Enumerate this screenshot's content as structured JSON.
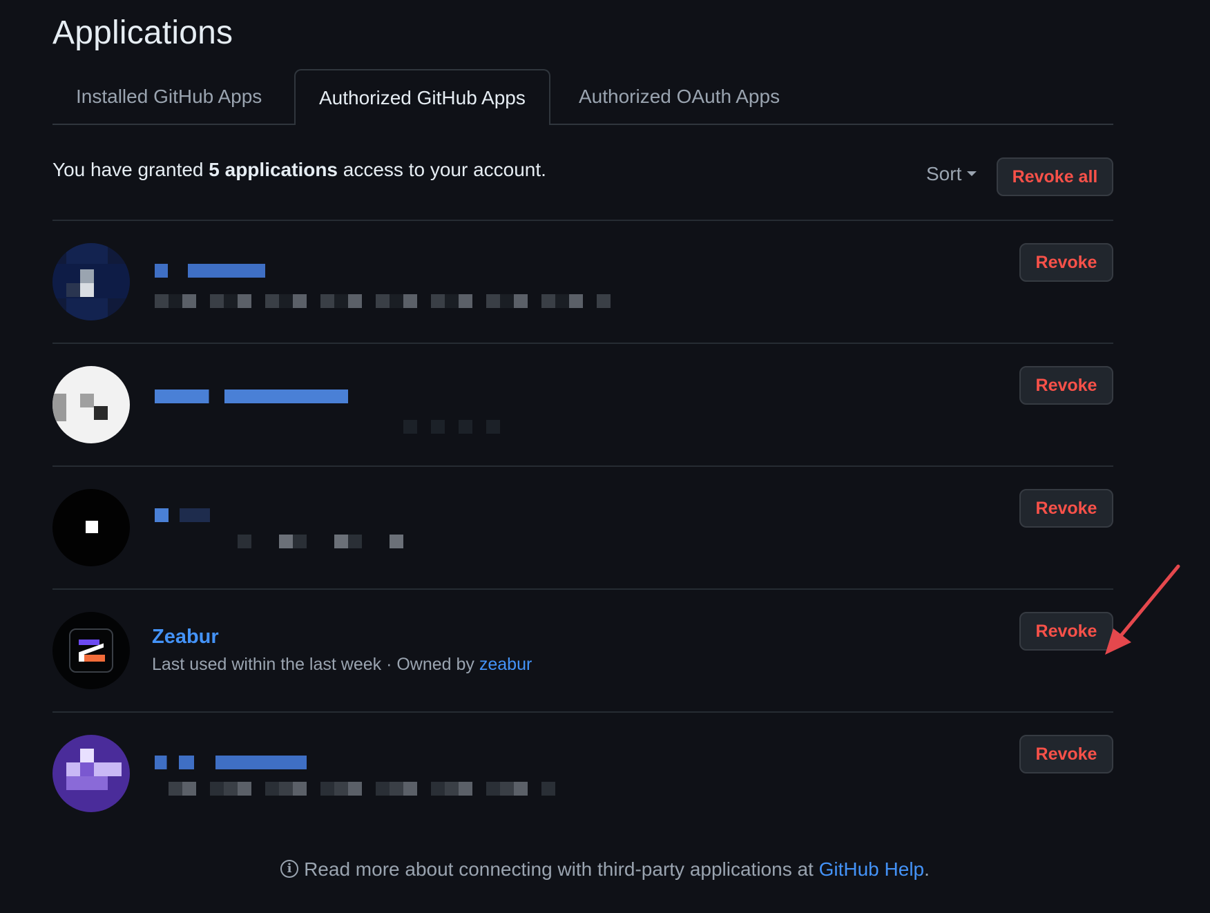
{
  "page": {
    "title": "Applications"
  },
  "tabs": [
    {
      "label": "Installed GitHub Apps",
      "active": false
    },
    {
      "label": "Authorized GitHub Apps",
      "active": true
    },
    {
      "label": "Authorized OAuth Apps",
      "active": false
    }
  ],
  "summary": {
    "prefix": "You have granted ",
    "count": "5 applications",
    "suffix": " access to your account."
  },
  "toolbar": {
    "sort_label": "Sort",
    "revoke_all_label": "Revoke all"
  },
  "apps": [
    {
      "name": "",
      "meta": "",
      "revoke_label": "Revoke",
      "redacted": true
    },
    {
      "name": "",
      "meta": "",
      "revoke_label": "Revoke",
      "redacted": true
    },
    {
      "name": "",
      "meta": "",
      "revoke_label": "Revoke",
      "redacted": true
    },
    {
      "name": "Zeabur",
      "meta_prefix": "Last used within the last week · Owned by ",
      "owner": "zeabur",
      "revoke_label": "Revoke",
      "redacted": false
    },
    {
      "name": "",
      "meta": "",
      "revoke_label": "Revoke",
      "redacted": true
    }
  ],
  "footer": {
    "text": "Read more about connecting with third-party applications at ",
    "link": "GitHub Help",
    "end": "."
  },
  "colors": {
    "background": "#0f1117",
    "link": "#4493f8",
    "danger": "#f85149",
    "annotation_arrow": "#e5484d"
  }
}
